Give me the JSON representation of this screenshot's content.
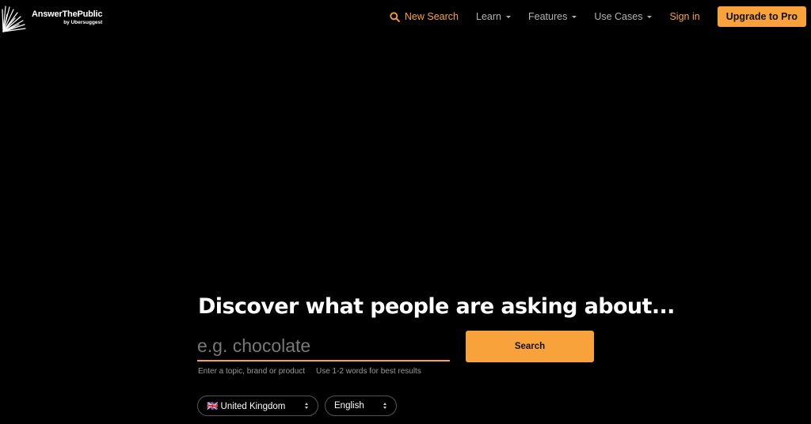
{
  "brand": {
    "name": "AnswerThePublic",
    "sub": "by Ubersuggest"
  },
  "nav": {
    "new_search": "New Search",
    "learn": "Learn",
    "features": "Features",
    "use_cases": "Use Cases",
    "sign_in": "Sign in",
    "upgrade": "Upgrade to Pro"
  },
  "hero": {
    "headline": "Discover what people are asking about...",
    "search_placeholder": "e.g. chocolate",
    "search_value": "",
    "search_button": "Search",
    "hint_topic": "Enter a topic, brand or product",
    "hint_words": "Use 1-2 words for best results"
  },
  "filters": {
    "country": "🇬🇧 United Kingdom",
    "language": "English"
  },
  "colors": {
    "accent": "#f7a23a",
    "background": "#000000",
    "nav_text": "#b3b3b3"
  },
  "icons": {
    "logo": "sunburst-logo-icon",
    "search": "search-icon",
    "dropdown": "caret-down-icon",
    "select": "select-arrows-icon"
  }
}
